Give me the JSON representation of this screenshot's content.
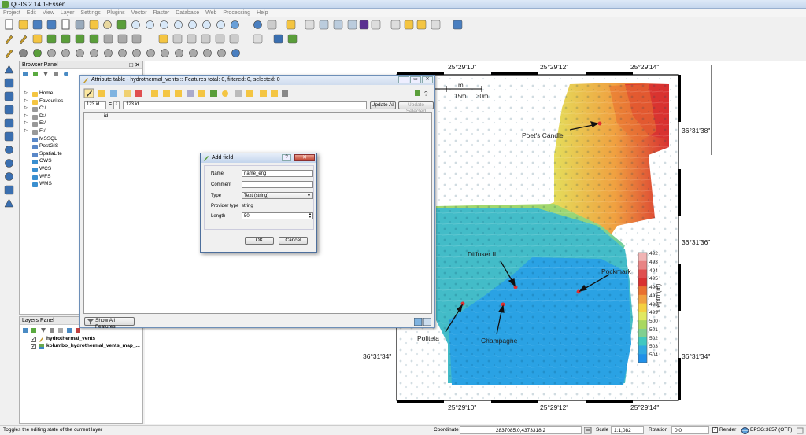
{
  "window": {
    "title": "QGIS 2.14.1-Essen"
  },
  "menu": [
    "Project",
    "Edit",
    "View",
    "Layer",
    "Settings",
    "Plugins",
    "Vector",
    "Raster",
    "Database",
    "Web",
    "Processing",
    "Help"
  ],
  "browser_panel": {
    "title": "Browser Panel",
    "items": [
      {
        "label": "Home",
        "icon": "folder-icon"
      },
      {
        "label": "Favourites",
        "icon": "star-icon"
      },
      {
        "label": "C:/",
        "icon": "drive-icon"
      },
      {
        "label": "D:/",
        "icon": "drive-icon"
      },
      {
        "label": "E:/",
        "icon": "drive-icon"
      },
      {
        "label": "F:/",
        "icon": "drive-icon"
      },
      {
        "label": "MSSQL",
        "icon": "database-icon"
      },
      {
        "label": "PostGIS",
        "icon": "database-icon"
      },
      {
        "label": "SpatiaLite",
        "icon": "database-icon"
      },
      {
        "label": "OWS",
        "icon": "globe-icon"
      },
      {
        "label": "WCS",
        "icon": "globe-icon"
      },
      {
        "label": "WFS",
        "icon": "globe-icon"
      },
      {
        "label": "WMS",
        "icon": "globe-icon"
      }
    ]
  },
  "layers_panel": {
    "title": "Layers Panel",
    "layers": [
      {
        "label": "hydrothermal_vents",
        "checked": true
      },
      {
        "label": "kolumbo_hydrothermal_vents_map_...",
        "checked": true
      }
    ]
  },
  "attribute_table": {
    "title": "Attribute table - hydrothermal_vents :: Features total: 0, filtered: 0, selected: 0",
    "field_select": "123 id",
    "expression_value": "123 id",
    "update_all": "Update All",
    "update_selected": "Update Selected",
    "column_header": "id",
    "show_all": "Show All Features"
  },
  "add_field": {
    "title": "Add field",
    "name_label": "Name",
    "name_value": "name_eng",
    "comment_label": "Comment",
    "comment_value": "",
    "type_label": "Type",
    "type_value": "Text (string)",
    "provider_label": "Provider type",
    "provider_value": "string",
    "length_label": "Length",
    "length_value": "50",
    "ok": "OK",
    "cancel": "Cancel"
  },
  "map": {
    "top_ticks": [
      "25°29'10\"",
      "25°29'12\"",
      "25°29'14\""
    ],
    "bottom_ticks": [
      "25°29'10\"",
      "25°29'12\"",
      "25°29'14\""
    ],
    "right_ticks": [
      "36°31'38\"",
      "36°31'36\"",
      "36°31'34\""
    ],
    "left_tick": "36°31'34\"",
    "scale_unit": "m",
    "scale_15": "15m",
    "scale_30": "30m",
    "vents": [
      "Poet's Candle",
      "Diffuser II",
      "Pockmark",
      "Politeia",
      "Champagne"
    ],
    "legend_title": "Depth (m)",
    "legend_values": [
      "492",
      "493",
      "494",
      "495",
      "496",
      "497",
      "498",
      "499",
      "500",
      "501",
      "502",
      "503",
      "504"
    ],
    "legend_colors": [
      "#f0b4b4",
      "#e88484",
      "#e05050",
      "#d83030",
      "#e87030",
      "#f0a040",
      "#f4d040",
      "#e0e860",
      "#a8d860",
      "#80d090",
      "#40c8c0",
      "#30a8e0",
      "#2090e8"
    ]
  },
  "status": {
    "message": "Toggles the editing state of the current layer",
    "coordinate_label": "Coordinate",
    "coordinate_value": "2837085.0,4373318.2",
    "scale_label": "Scale",
    "scale_value": "1:1,082",
    "rotation_label": "Rotation",
    "rotation_value": "0.0",
    "render_label": "Render",
    "crs": "EPSG:3857 (OTF)"
  }
}
